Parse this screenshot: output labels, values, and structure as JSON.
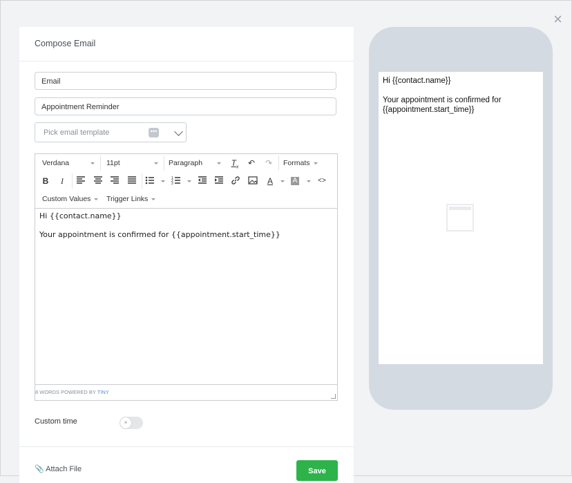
{
  "modal": {
    "close_symbol": "×"
  },
  "panel": {
    "title": "Compose Email",
    "email_value": "Email",
    "subject_value": "Appointment Reminder",
    "template_placeholder": "Pick email template",
    "template_dots": "•••"
  },
  "toolbar": {
    "font_family": "Verdana",
    "font_size": "11pt",
    "block_format": "Paragraph",
    "formats": "Formats",
    "custom_values": "Custom Values",
    "trigger_links": "Trigger Links",
    "icons": [
      "clear-formatting-icon",
      "undo-icon",
      "redo-icon",
      "bold-icon",
      "italic-icon",
      "align-left-icon",
      "align-center-icon",
      "align-right-icon",
      "align-justify-icon",
      "bullet-list-icon",
      "numbered-list-icon",
      "outdent-icon",
      "indent-icon",
      "link-icon",
      "image-icon",
      "text-color-icon",
      "background-color-icon",
      "source-code-icon"
    ]
  },
  "editor": {
    "line1": "Hi {{contact.name}}",
    "line2": "Your appointment is confirmed for {{appointment.start_time}}",
    "status_words": "8 WORDS POWERED BY ",
    "status_brand": "TINY"
  },
  "custom_time": {
    "label": "Custom time",
    "enabled": false,
    "knob_symbol": "×"
  },
  "footer": {
    "attach_label": "Attach File",
    "save_label": "Save"
  },
  "preview": {
    "line1": "Hi {{contact.name}}",
    "line2": "Your appointment is confirmed for {{appointment.start_time}}"
  },
  "colors": {
    "save": "#2db34a",
    "phone": "#d4dae1",
    "brand": "#5b8fc6"
  }
}
